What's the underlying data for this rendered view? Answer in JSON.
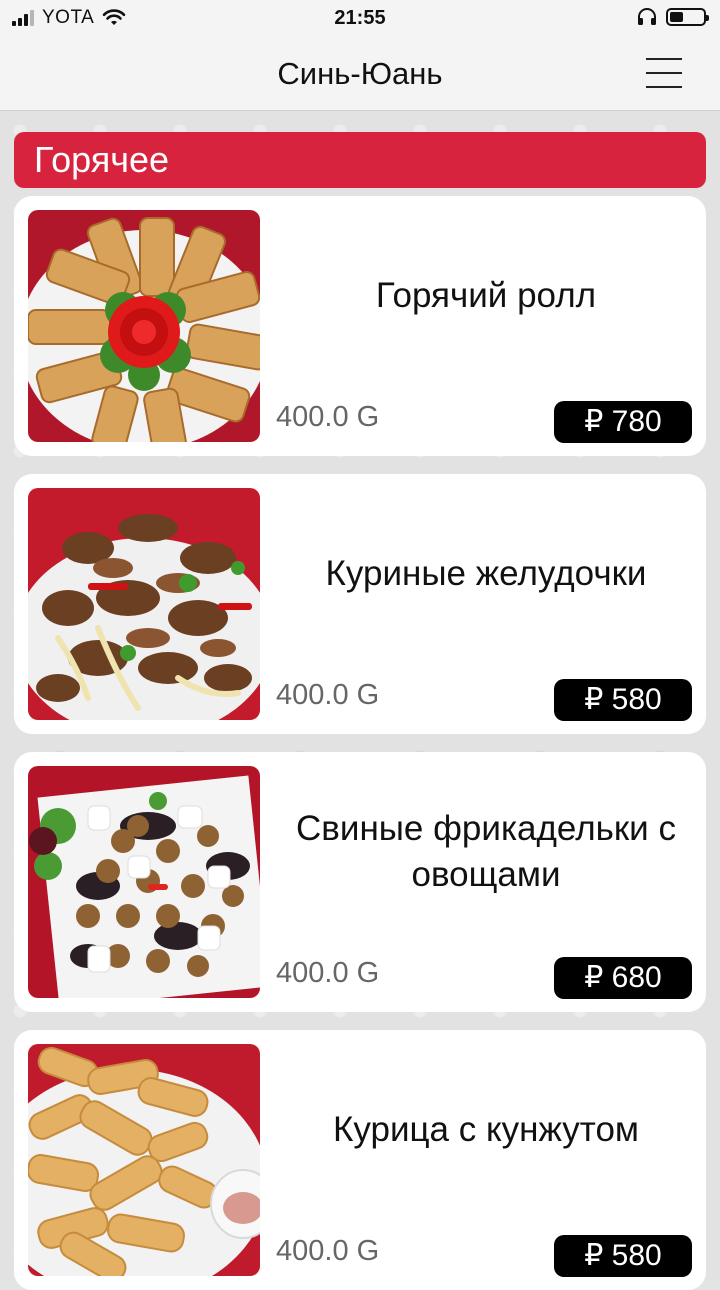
{
  "status_bar": {
    "carrier": "YOTA",
    "time": "21:55"
  },
  "nav": {
    "title": "Синь-Юань"
  },
  "section": {
    "title": "Горячее"
  },
  "items": [
    {
      "name": "Горячий ролл",
      "weight": "400.0 G",
      "price": "₽ 780"
    },
    {
      "name": "Куриные желудочки",
      "weight": "400.0 G",
      "price": "₽ 580"
    },
    {
      "name": "Свиные фрикадельки с овощами",
      "weight": "400.0 G",
      "price": "₽ 680"
    },
    {
      "name": "Курица с кунжутом",
      "weight": "400.0 G",
      "price": "₽ 580"
    }
  ],
  "colors": {
    "accent": "#d8233f",
    "price_badge": "#000000",
    "card_bg": "#ffffff"
  },
  "icons": [
    "signal-icon",
    "wifi-icon",
    "headphones-icon",
    "battery-icon",
    "menu-icon"
  ]
}
